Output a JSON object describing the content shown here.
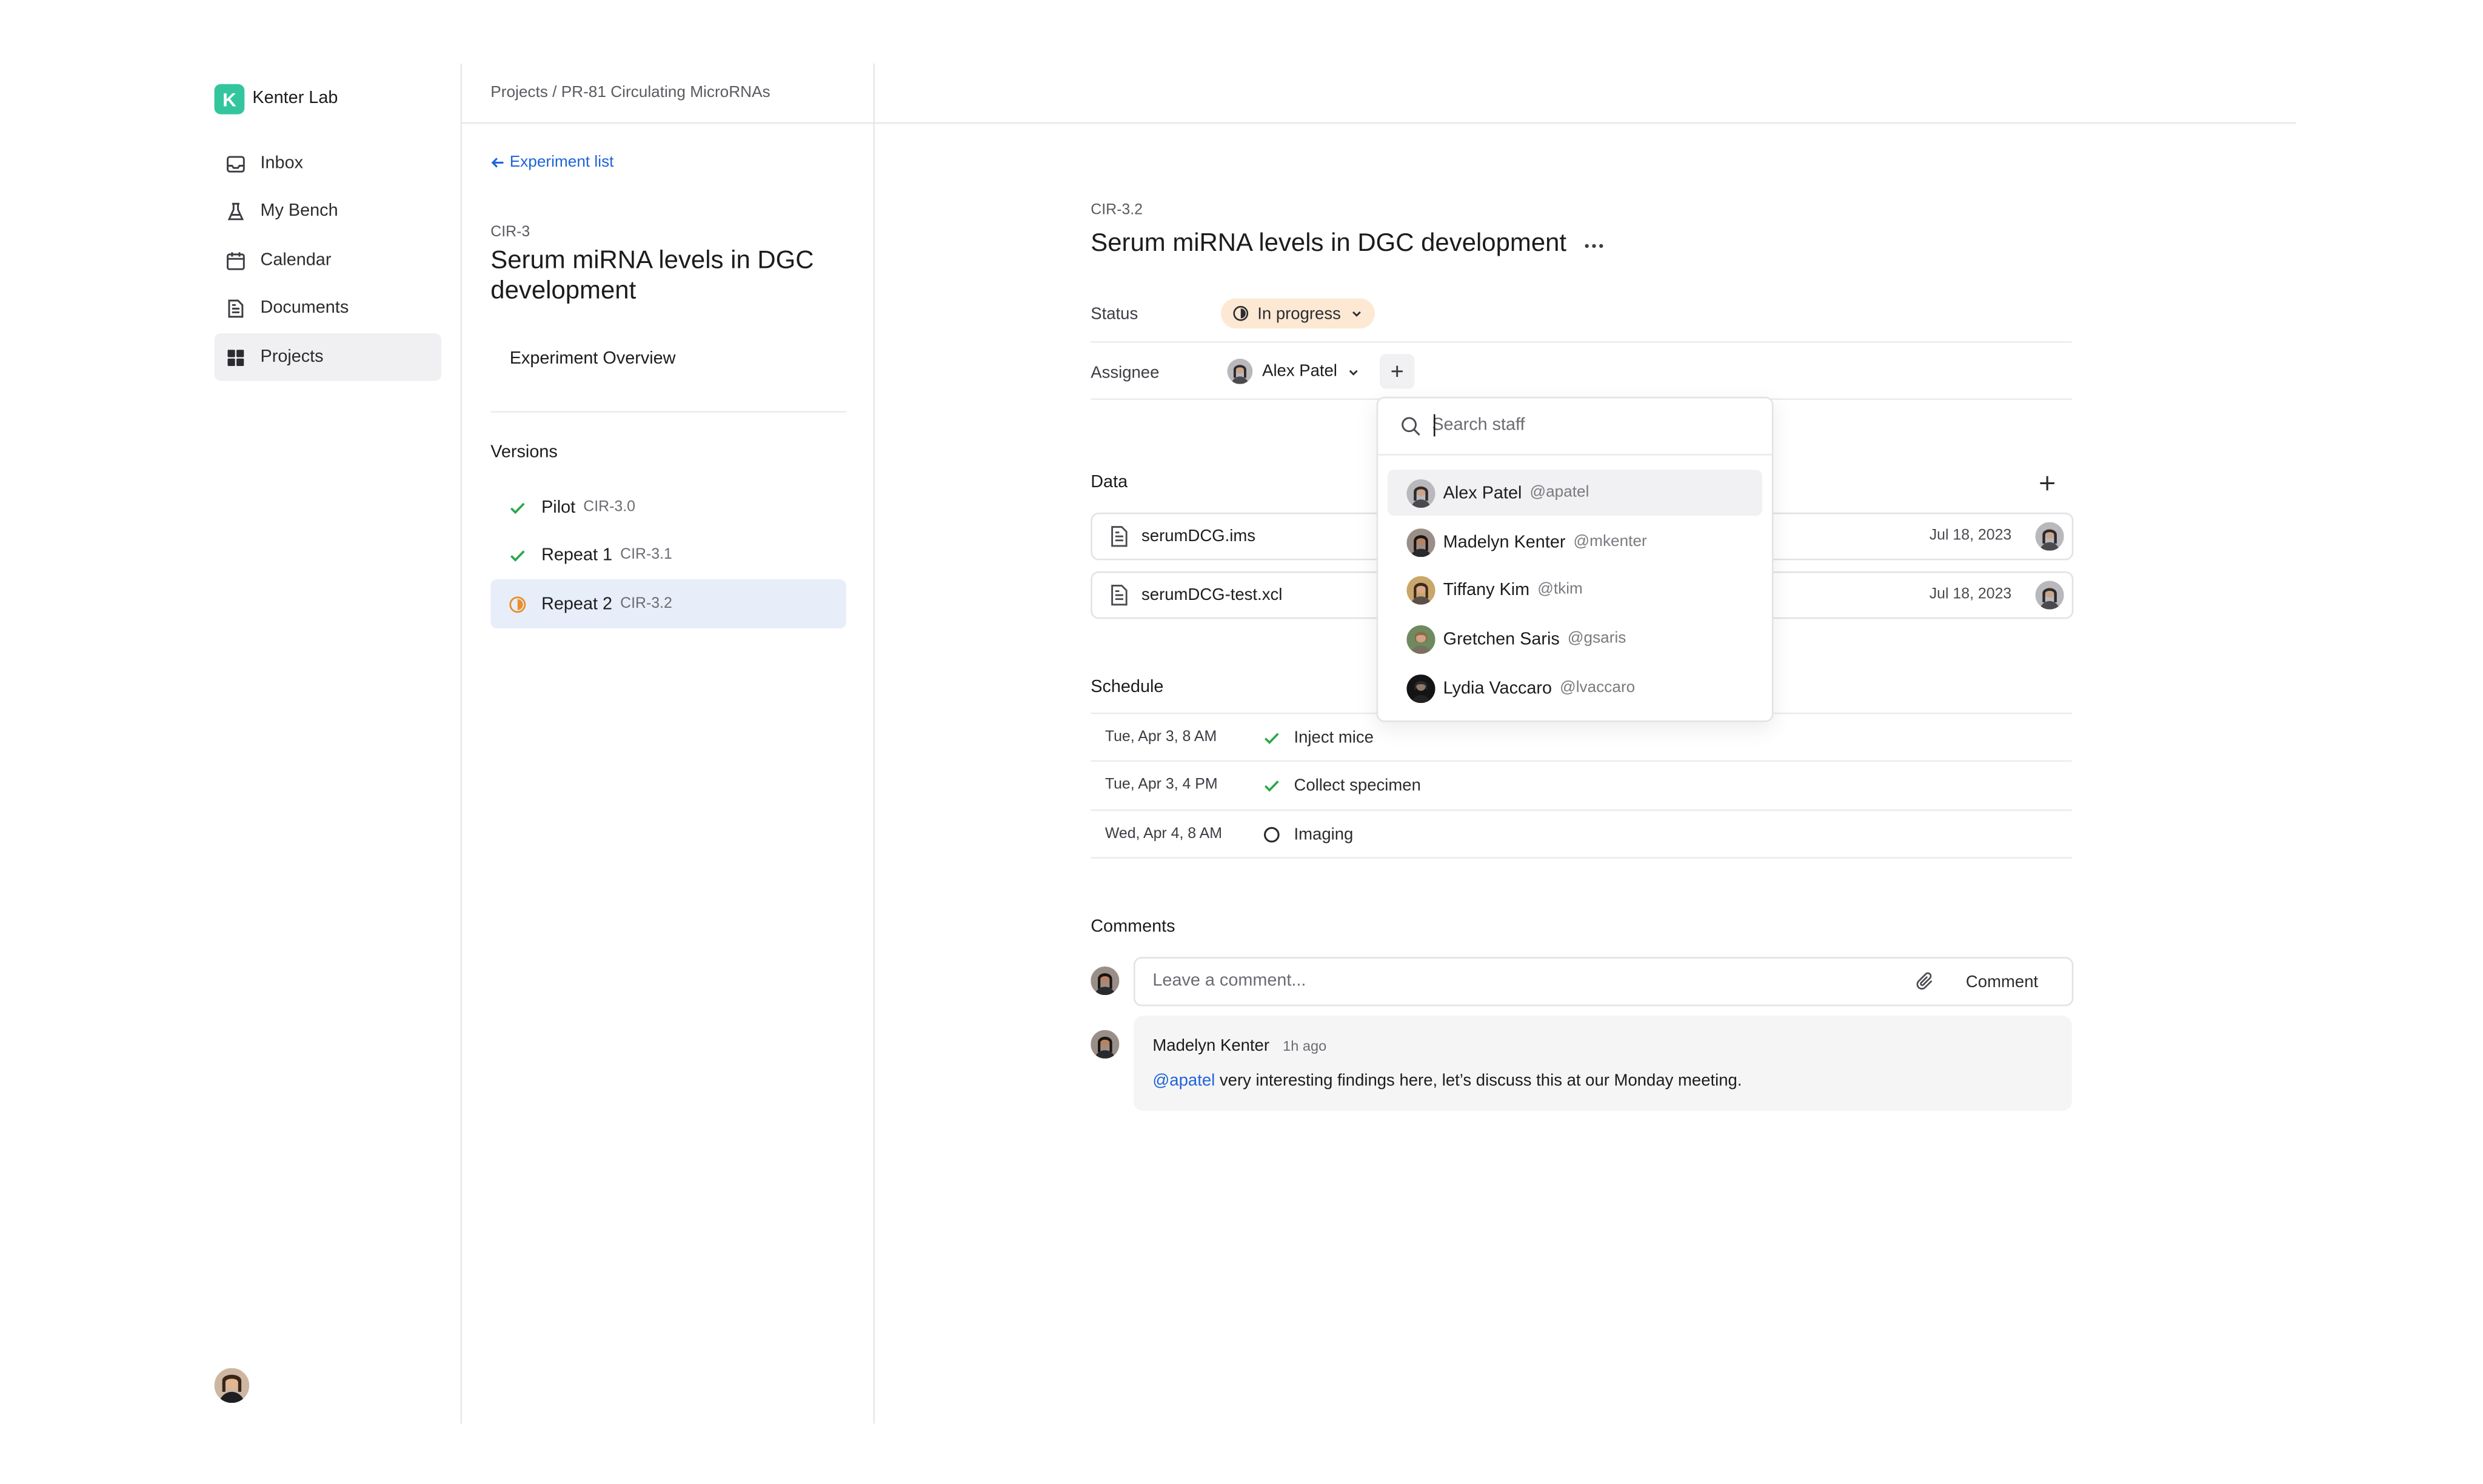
{
  "sidebar": {
    "lab_name": "Kenter Lab",
    "logo_letter": "K",
    "nav": [
      {
        "label": "Inbox",
        "icon": "inbox-icon"
      },
      {
        "label": "My Bench",
        "icon": "flask-icon"
      },
      {
        "label": "Calendar",
        "icon": "calendar-icon"
      },
      {
        "label": "Documents",
        "icon": "document-icon"
      },
      {
        "label": "Projects",
        "icon": "grid-icon",
        "active": true
      }
    ]
  },
  "header": {
    "breadcrumb": "Projects / PR-81 Circulating MicroRNAs"
  },
  "experiment": {
    "back_label": "Experiment list",
    "code": "CIR-3",
    "title": "Serum miRNA levels in DGC development",
    "overview_label": "Experiment Overview",
    "versions_heading": "Versions",
    "versions": [
      {
        "name": "Pilot",
        "code": "CIR-3.0",
        "status": "done"
      },
      {
        "name": "Repeat 1",
        "code": "CIR-3.1",
        "status": "done"
      },
      {
        "name": "Repeat 2",
        "code": "CIR-3.2",
        "status": "in-progress",
        "active": true
      }
    ]
  },
  "detail": {
    "code": "CIR-3.2",
    "title": "Serum miRNA levels in DGC development",
    "status_label": "Status",
    "status_value": "In progress",
    "assignee_label": "Assignee",
    "assignee_name": "Alex Patel",
    "data_heading": "Data",
    "files": [
      {
        "name": "serumDCG.ims",
        "date": "Jul 18, 2023"
      },
      {
        "name": "serumDCG-test.xcl",
        "date": "Jul 18, 2023"
      }
    ],
    "schedule_heading": "Schedule",
    "schedule": [
      {
        "time": "Tue, Apr 3, 8 AM",
        "task": "Inject mice",
        "status": "done"
      },
      {
        "time": "Tue, Apr 3, 4 PM",
        "task": "Collect specimen",
        "status": "done"
      },
      {
        "time": "Wed, Apr 4, 8 AM",
        "task": "Imaging",
        "status": "pending"
      }
    ],
    "comments_heading": "Comments",
    "comment_placeholder": "Leave a comment...",
    "comment_button": "Comment",
    "comments": [
      {
        "author": "Madelyn Kenter",
        "time": "1h ago",
        "mention": "@apatel",
        "body": " very interesting findings here, let’s discuss this at our Monday meeting."
      }
    ]
  },
  "staff_dropdown": {
    "search_placeholder": "Search staff",
    "staff": [
      {
        "name": "Alex Patel",
        "handle": "@apatel",
        "highlighted": true
      },
      {
        "name": "Madelyn Kenter",
        "handle": "@mkenter"
      },
      {
        "name": "Tiffany Kim",
        "handle": "@tkim"
      },
      {
        "name": "Gretchen Saris",
        "handle": "@gsaris"
      },
      {
        "name": "Lydia Vaccaro",
        "handle": "@lvaccaro"
      }
    ]
  },
  "colors": {
    "accent_blue": "#1f63d8",
    "logo_green": "#33c69e",
    "success_green": "#2aa84a",
    "in_progress_orange": "#e8902a",
    "status_badge_bg": "#fde9d3",
    "active_version_bg": "#e8eef9"
  }
}
